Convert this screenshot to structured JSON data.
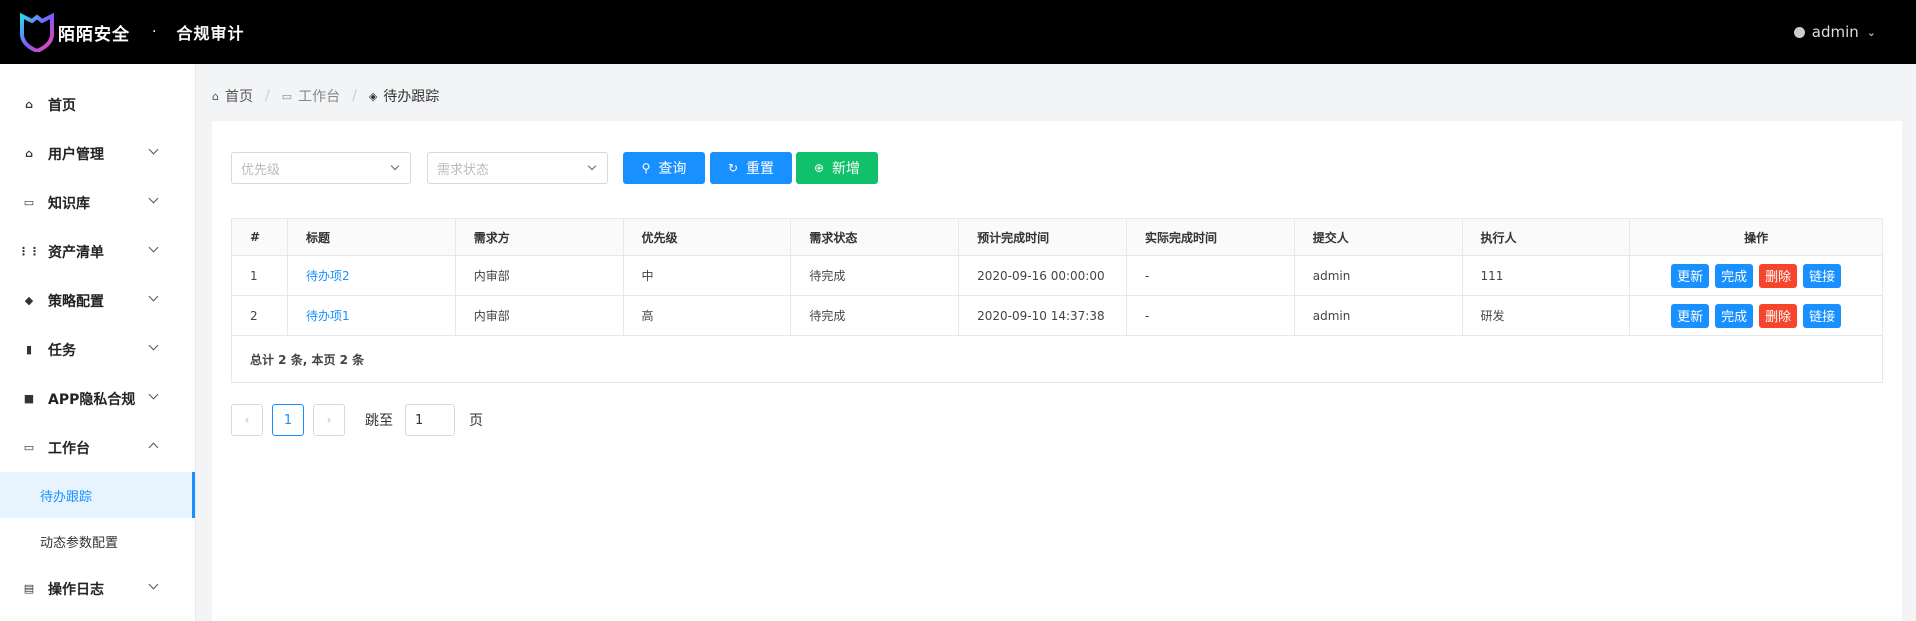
{
  "header": {
    "brand": "陌陌安全",
    "separator": "·",
    "app_title": "合规审计",
    "user": "admin"
  },
  "sidebar": {
    "items": [
      {
        "label": "首页",
        "icon": "home-icon"
      },
      {
        "label": "用户管理",
        "icon": "home-icon",
        "expandable": true
      },
      {
        "label": "知识库",
        "icon": "book-icon",
        "expandable": true
      },
      {
        "label": "资产清单",
        "icon": "grid-icon",
        "expandable": true
      },
      {
        "label": "策略配置",
        "icon": "cube-icon",
        "expandable": true
      },
      {
        "label": "任务",
        "icon": "bar-chart-icon",
        "expandable": true
      },
      {
        "label": "APP隐私合规",
        "icon": "briefcase-icon",
        "expandable": true
      },
      {
        "label": "工作台",
        "icon": "desktop-icon",
        "expanded": true
      },
      {
        "label": "操作日志",
        "icon": "log-icon",
        "expandable": true
      }
    ],
    "sub_items": [
      {
        "label": "待办跟踪",
        "active": true
      },
      {
        "label": "动态参数配置"
      }
    ]
  },
  "breadcrumb": [
    "首页",
    "工作台",
    "待办跟踪"
  ],
  "filters": {
    "priority_placeholder": "优先级",
    "status_placeholder": "需求状态"
  },
  "buttons": {
    "query": "查询",
    "reset": "重置",
    "add": "新增"
  },
  "table": {
    "columns": [
      "#",
      "标题",
      "需求方",
      "优先级",
      "需求状态",
      "预计完成时间",
      "实际完成时间",
      "提交人",
      "执行人",
      "操作"
    ],
    "rows": [
      [
        "1",
        "待办项2",
        "内审部",
        "中",
        "待完成",
        "2020-09-16 00:00:00",
        "-",
        "admin",
        "111"
      ],
      [
        "2",
        "待办项1",
        "内审部",
        "高",
        "待完成",
        "2020-09-10 14:37:38",
        "-",
        "admin",
        "研发"
      ]
    ],
    "actions": [
      "更新",
      "完成",
      "删除",
      "链接"
    ],
    "footer": "总计 2 条, 本页 2 条"
  },
  "pagination": {
    "current_page": "1",
    "jump_label": "跳至",
    "jump_value": "1",
    "page_suffix": "页"
  },
  "colors": {
    "primary": "#1890ff",
    "success": "#10c06a",
    "danger": "#f5462d",
    "header_bg": "#000000"
  }
}
